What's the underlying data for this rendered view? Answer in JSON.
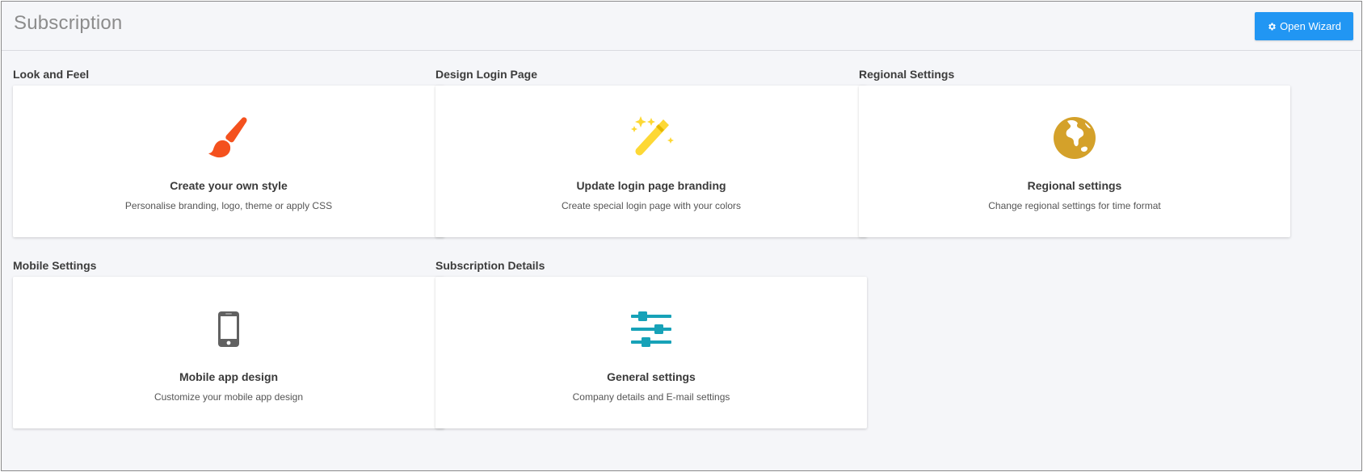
{
  "header": {
    "title": "Subscription",
    "wizard_button_label": "Open Wizard",
    "wizard_icon": "gear-icon"
  },
  "sections": [
    {
      "heading": "Look and Feel",
      "card": {
        "icon": "paintbrush-icon",
        "icon_color": "#f4511e",
        "title": "Create your own style",
        "description": "Personalise branding, logo, theme or apply CSS"
      }
    },
    {
      "heading": "Design Login Page",
      "card": {
        "icon": "magic-wand-icon",
        "icon_color": "#fdd835",
        "title": "Update login page branding",
        "description": "Create special login page with your colors"
      }
    },
    {
      "heading": "Regional Settings",
      "card": {
        "icon": "globe-icon",
        "icon_color": "#d4a12a",
        "title": "Regional settings",
        "description": "Change regional settings for time format"
      }
    },
    {
      "heading": "Mobile Settings",
      "card": {
        "icon": "mobile-phone-icon",
        "icon_color": "#616161",
        "title": "Mobile app design",
        "description": "Customize your mobile app design"
      }
    },
    {
      "heading": "Subscription Details",
      "card": {
        "icon": "sliders-icon",
        "icon_color": "#17a2b8",
        "title": "General settings",
        "description": "Company details and E-mail settings"
      }
    }
  ],
  "colors": {
    "accent": "#2196f3",
    "background": "#f5f6f9",
    "card": "#ffffff"
  }
}
